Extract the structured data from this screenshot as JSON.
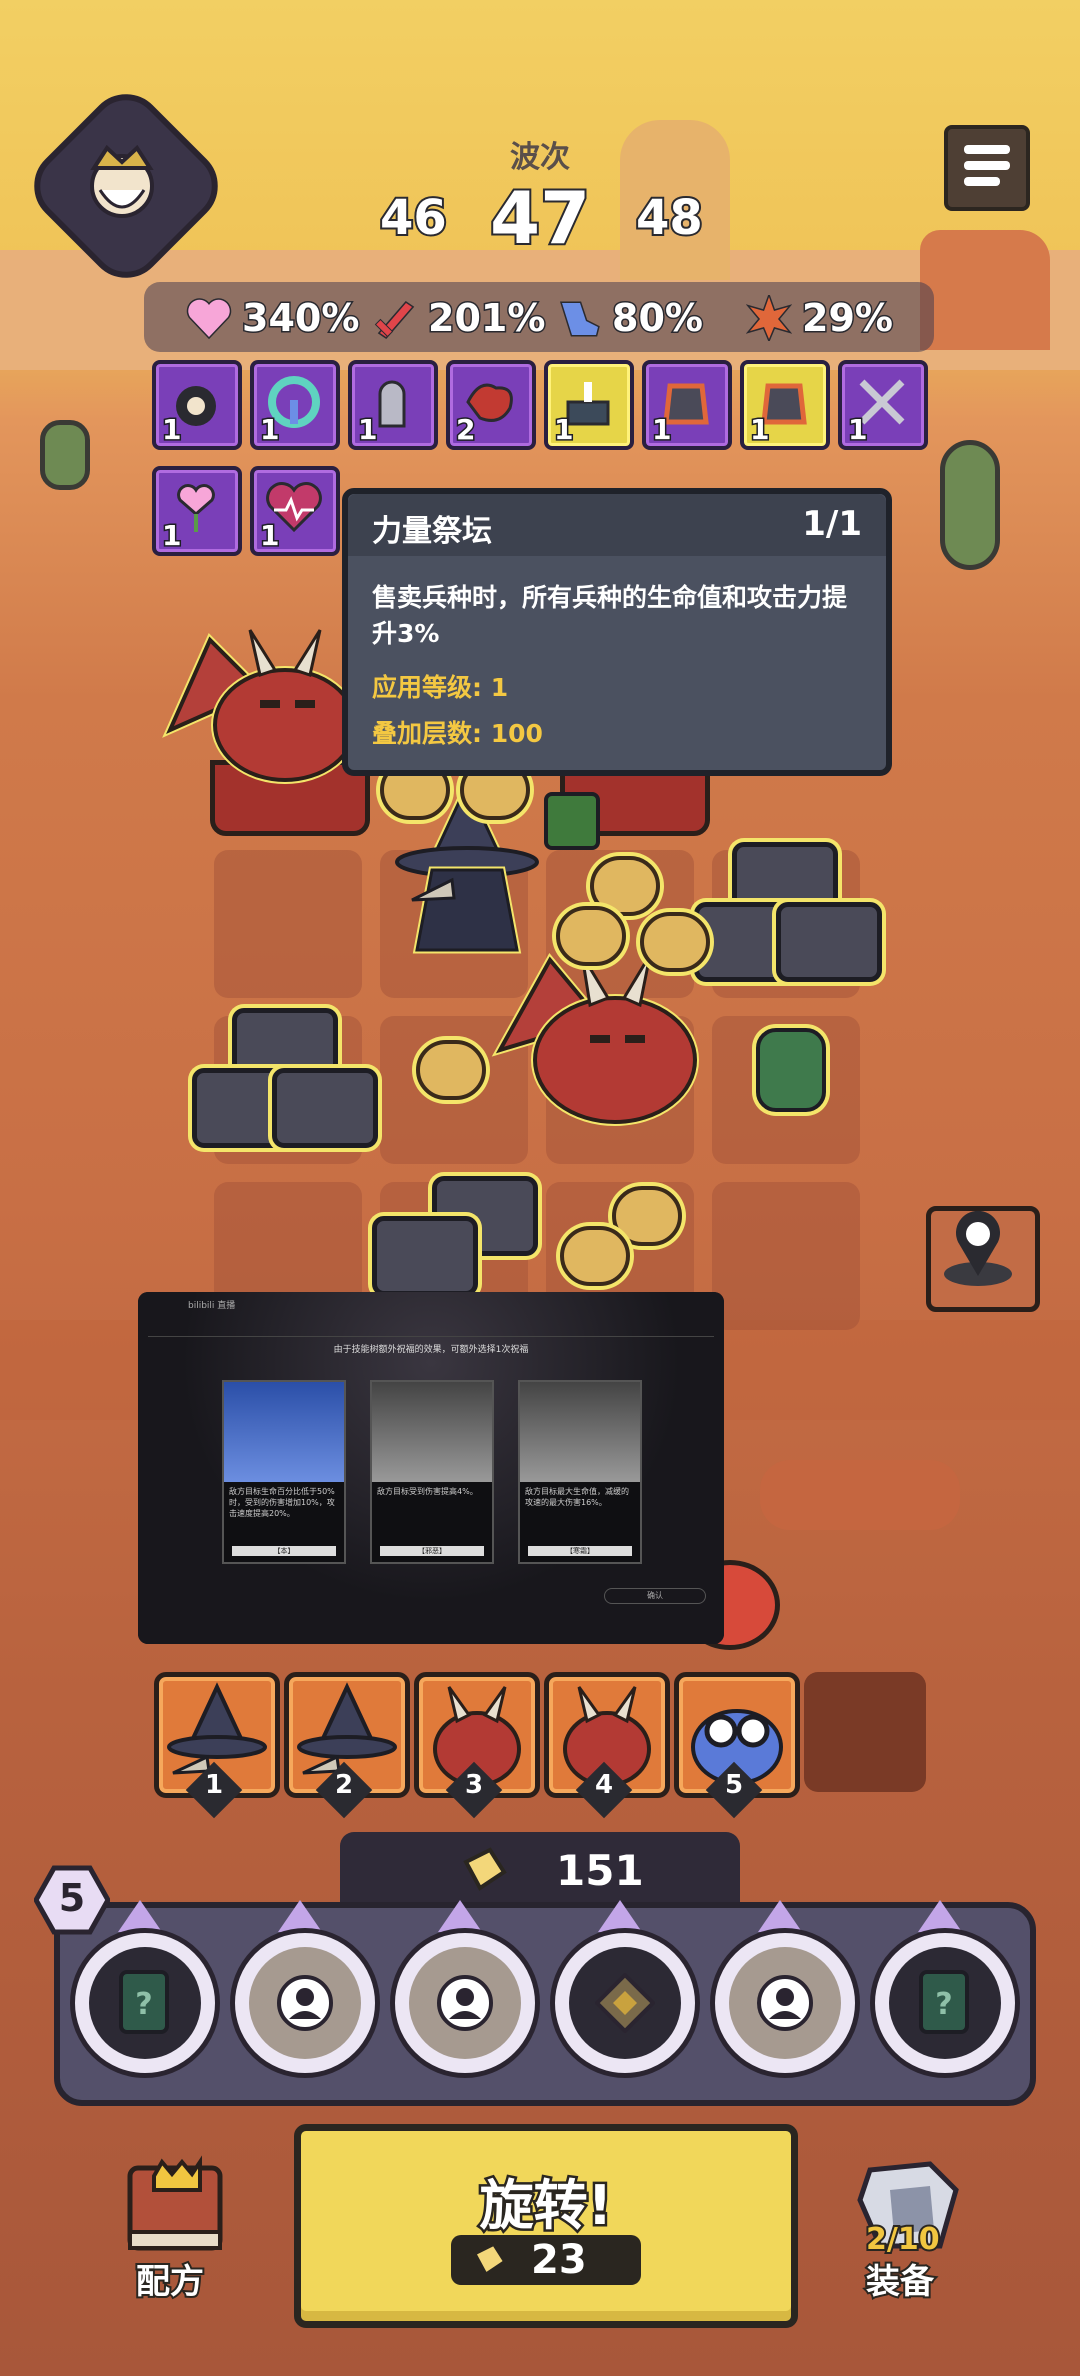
{
  "wave": {
    "label": "波次",
    "previous": "46",
    "current": "47",
    "next": "48"
  },
  "stats": [
    {
      "icon": "heart-icon",
      "value": "340%",
      "color": "#f7a6d8"
    },
    {
      "icon": "sword-icon",
      "value": "201%",
      "color": "#e0454a"
    },
    {
      "icon": "boot-icon",
      "value": "80%",
      "color": "#6c8fe6"
    },
    {
      "icon": "burst-icon",
      "value": "29%",
      "color": "#e0673a"
    }
  ],
  "buffs": [
    {
      "icon": "bomb-skull-icon",
      "count": "1"
    },
    {
      "icon": "speed-gauge-icon",
      "count": "1"
    },
    {
      "icon": "tombstone-icon",
      "count": "1"
    },
    {
      "icon": "blood-splash-icon",
      "count": "2"
    },
    {
      "icon": "altar-icon",
      "count": "1"
    },
    {
      "icon": "fire-armor-icon",
      "count": "1"
    },
    {
      "icon": "fire-armor-gold-icon",
      "count": "1"
    },
    {
      "icon": "crossed-swords-icon",
      "count": "1"
    },
    {
      "icon": "heart-flower-icon",
      "count": "1"
    },
    {
      "icon": "heartbeat-icon",
      "count": "1"
    }
  ],
  "tooltip": {
    "title": "力量祭坛",
    "level": "1/1",
    "description": "售卖兵种时，所有兵种的生命值和攻击力提升3%",
    "apply_level": "应用等级: 1",
    "stack_count": "叠加层数: 100"
  },
  "overlay": {
    "brand": "bilibili 直播",
    "subheader": "由于技能树额外祝福的效果，可额外选择1次祝福",
    "confirm": "确认",
    "cards": [
      {
        "title": "",
        "text": "敌方目标生命百分比低于50%时，受到的伤害增加10%，攻击速度提高20%。",
        "foot": "【本】"
      },
      {
        "title": "",
        "text": "敌方目标受到伤害提高4%。",
        "foot": "【邪恶】"
      },
      {
        "title": "",
        "text": "敌方目标最大生命值，减缓的攻速的最大伤害16%。",
        "foot": "【寒霜】"
      }
    ]
  },
  "deck": [
    {
      "name": "wizard",
      "number": "1"
    },
    {
      "name": "wizard",
      "number": "2"
    },
    {
      "name": "dragon",
      "number": "3"
    },
    {
      "name": "dragon",
      "number": "4"
    },
    {
      "name": "goggles-blob",
      "number": "5"
    }
  ],
  "coins": {
    "value": "151"
  },
  "rings": {
    "level": "5",
    "slots": [
      "card-icon",
      "portrait-icon",
      "portrait-icon",
      "diamond-icon",
      "portrait-icon",
      "card-icon"
    ]
  },
  "bottom": {
    "recipe_label": "配方",
    "spin_label": "旋转!",
    "spin_cost": "23",
    "equip_count": "2/10",
    "equip_label": "装备"
  },
  "colors": {
    "buff_purple": "#7a3fb8",
    "spin_yellow": "#f1d75a",
    "tooltip_bg": "#4b5160",
    "gold_text": "#f4c842"
  }
}
